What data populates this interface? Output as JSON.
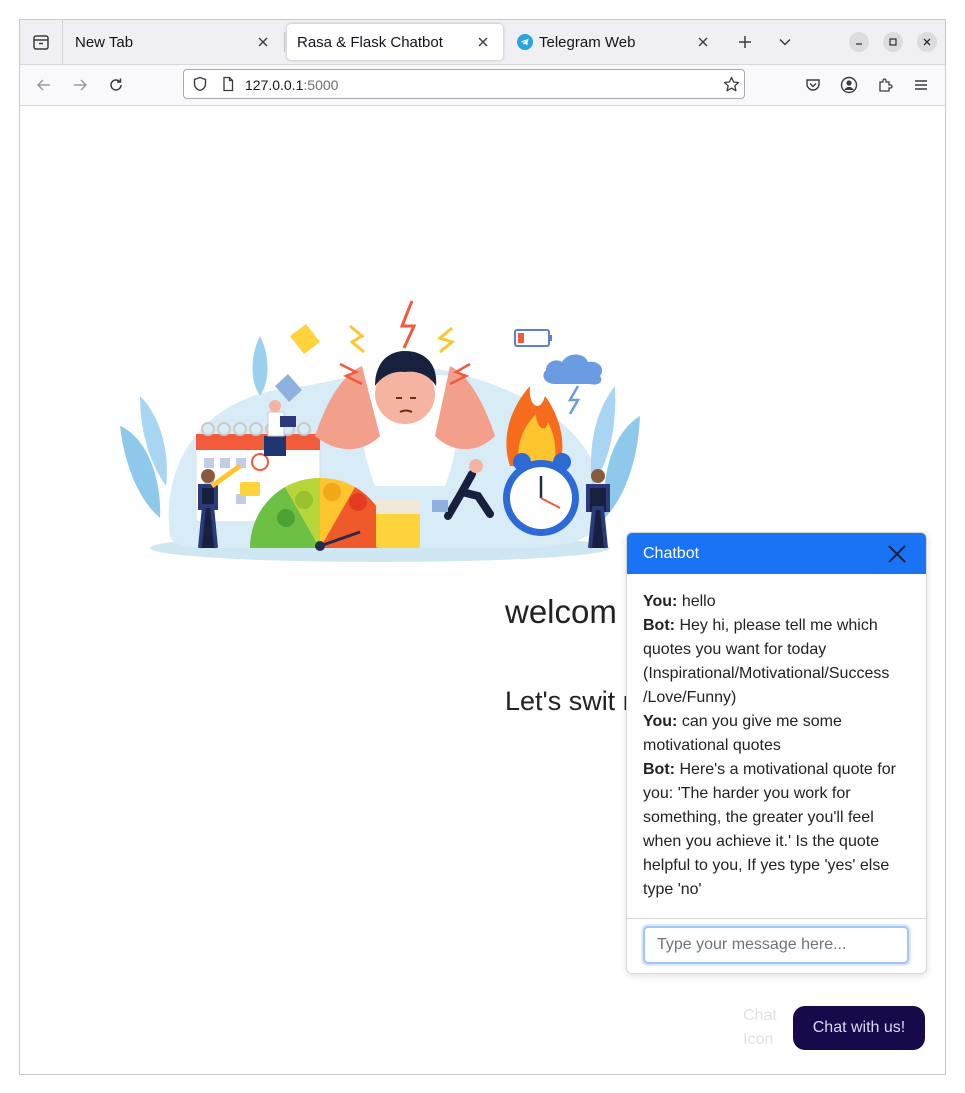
{
  "browser": {
    "tabs": [
      {
        "label": "New Tab",
        "active": false
      },
      {
        "label": "Rasa & Flask Chatbot",
        "active": true
      },
      {
        "label": "Telegram Web",
        "active": false,
        "icon": "telegram-icon"
      }
    ],
    "url_host": "127.0.0.1",
    "url_port": ":5000",
    "colors": {
      "tabstrip": "#f0f0f4",
      "navbar": "#f9f9fb"
    }
  },
  "page": {
    "welcome_text": "welcome to my Chatbot",
    "welcome_visible": "welcom my Cha",
    "tagline_text": "Let's switch your mood!",
    "tagline_visible": "Let's swit mood!",
    "hero_icon": "stressed-man-illustration"
  },
  "chat": {
    "title": "Chatbot",
    "header_color": "#1a73f5",
    "messages": [
      {
        "speaker": "You:",
        "text": "hello"
      },
      {
        "speaker": "Bot:",
        "text": "Hey hi, please tell me which quotes you want for today (Inspirational/Motivational/Success /Love/Funny)"
      },
      {
        "speaker": "You:",
        "text": "can you give me some motivational quotes"
      },
      {
        "speaker": "Bot:",
        "text": "Here's a motivational quote for you: 'The harder you work for something, the greater you'll feel when you achieve it.' Is the quote helpful to you, If yes type 'yes' else type 'no'"
      }
    ],
    "input_value": "",
    "input_placeholder": "Type your message here...",
    "icon_alt_text": "Chat Icon",
    "launch_label": "Chat with us!",
    "launch_color": "#180a4a"
  }
}
